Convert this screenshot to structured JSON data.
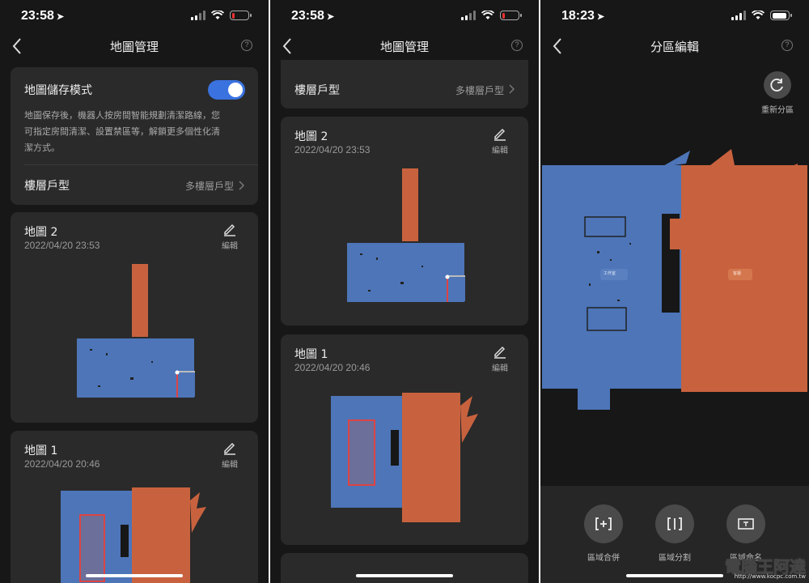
{
  "screens": [
    {
      "status": {
        "time": "23:58"
      },
      "nav": {
        "title": "地圖管理"
      },
      "mode_card": {
        "title": "地圖儲存模式",
        "description_lines": [
          "地圖保存後，機器人按房間智能規劃清潔路線，您",
          "可指定房間清潔、設置禁區等，解鎖更多個性化清",
          "潔方式。"
        ],
        "toggle_on": true,
        "floor_label": "樓層戶型",
        "floor_value": "多樓層戶型"
      },
      "maps": [
        {
          "name": "地圖 2",
          "date": "2022/04/20 23:53",
          "edit_label": "編輯"
        },
        {
          "name": "地圖 1",
          "date": "2022/04/20 20:46",
          "edit_label": "編輯"
        }
      ]
    },
    {
      "status": {
        "time": "23:58"
      },
      "nav": {
        "title": "地圖管理"
      },
      "floor_row": {
        "label": "樓層戶型",
        "value": "多樓層戶型"
      },
      "maps": [
        {
          "name": "地圖 2",
          "date": "2022/04/20 23:53",
          "edit_label": "編輯"
        },
        {
          "name": "地圖 1",
          "date": "2022/04/20 20:46",
          "edit_label": "編輯"
        }
      ]
    },
    {
      "status": {
        "time": "18:23"
      },
      "nav": {
        "title": "分區編輯"
      },
      "repartition_label": "重新分區",
      "room_tags": [
        "工作室",
        "客廳"
      ],
      "actions": [
        {
          "label": "區域合併",
          "icon": "merge-icon"
        },
        {
          "label": "區域分割",
          "icon": "split-icon"
        },
        {
          "label": "區域命名",
          "icon": "rename-icon"
        }
      ]
    }
  ],
  "watermark": {
    "text": "電腦王阿達",
    "url": "http://www.kocpc.com.tw"
  },
  "colors": {
    "blue_room": "#4d75b8",
    "orange_room": "#c8623e",
    "toggle": "#3a72e0",
    "background": "#171717",
    "card": "#2a2a2a"
  }
}
